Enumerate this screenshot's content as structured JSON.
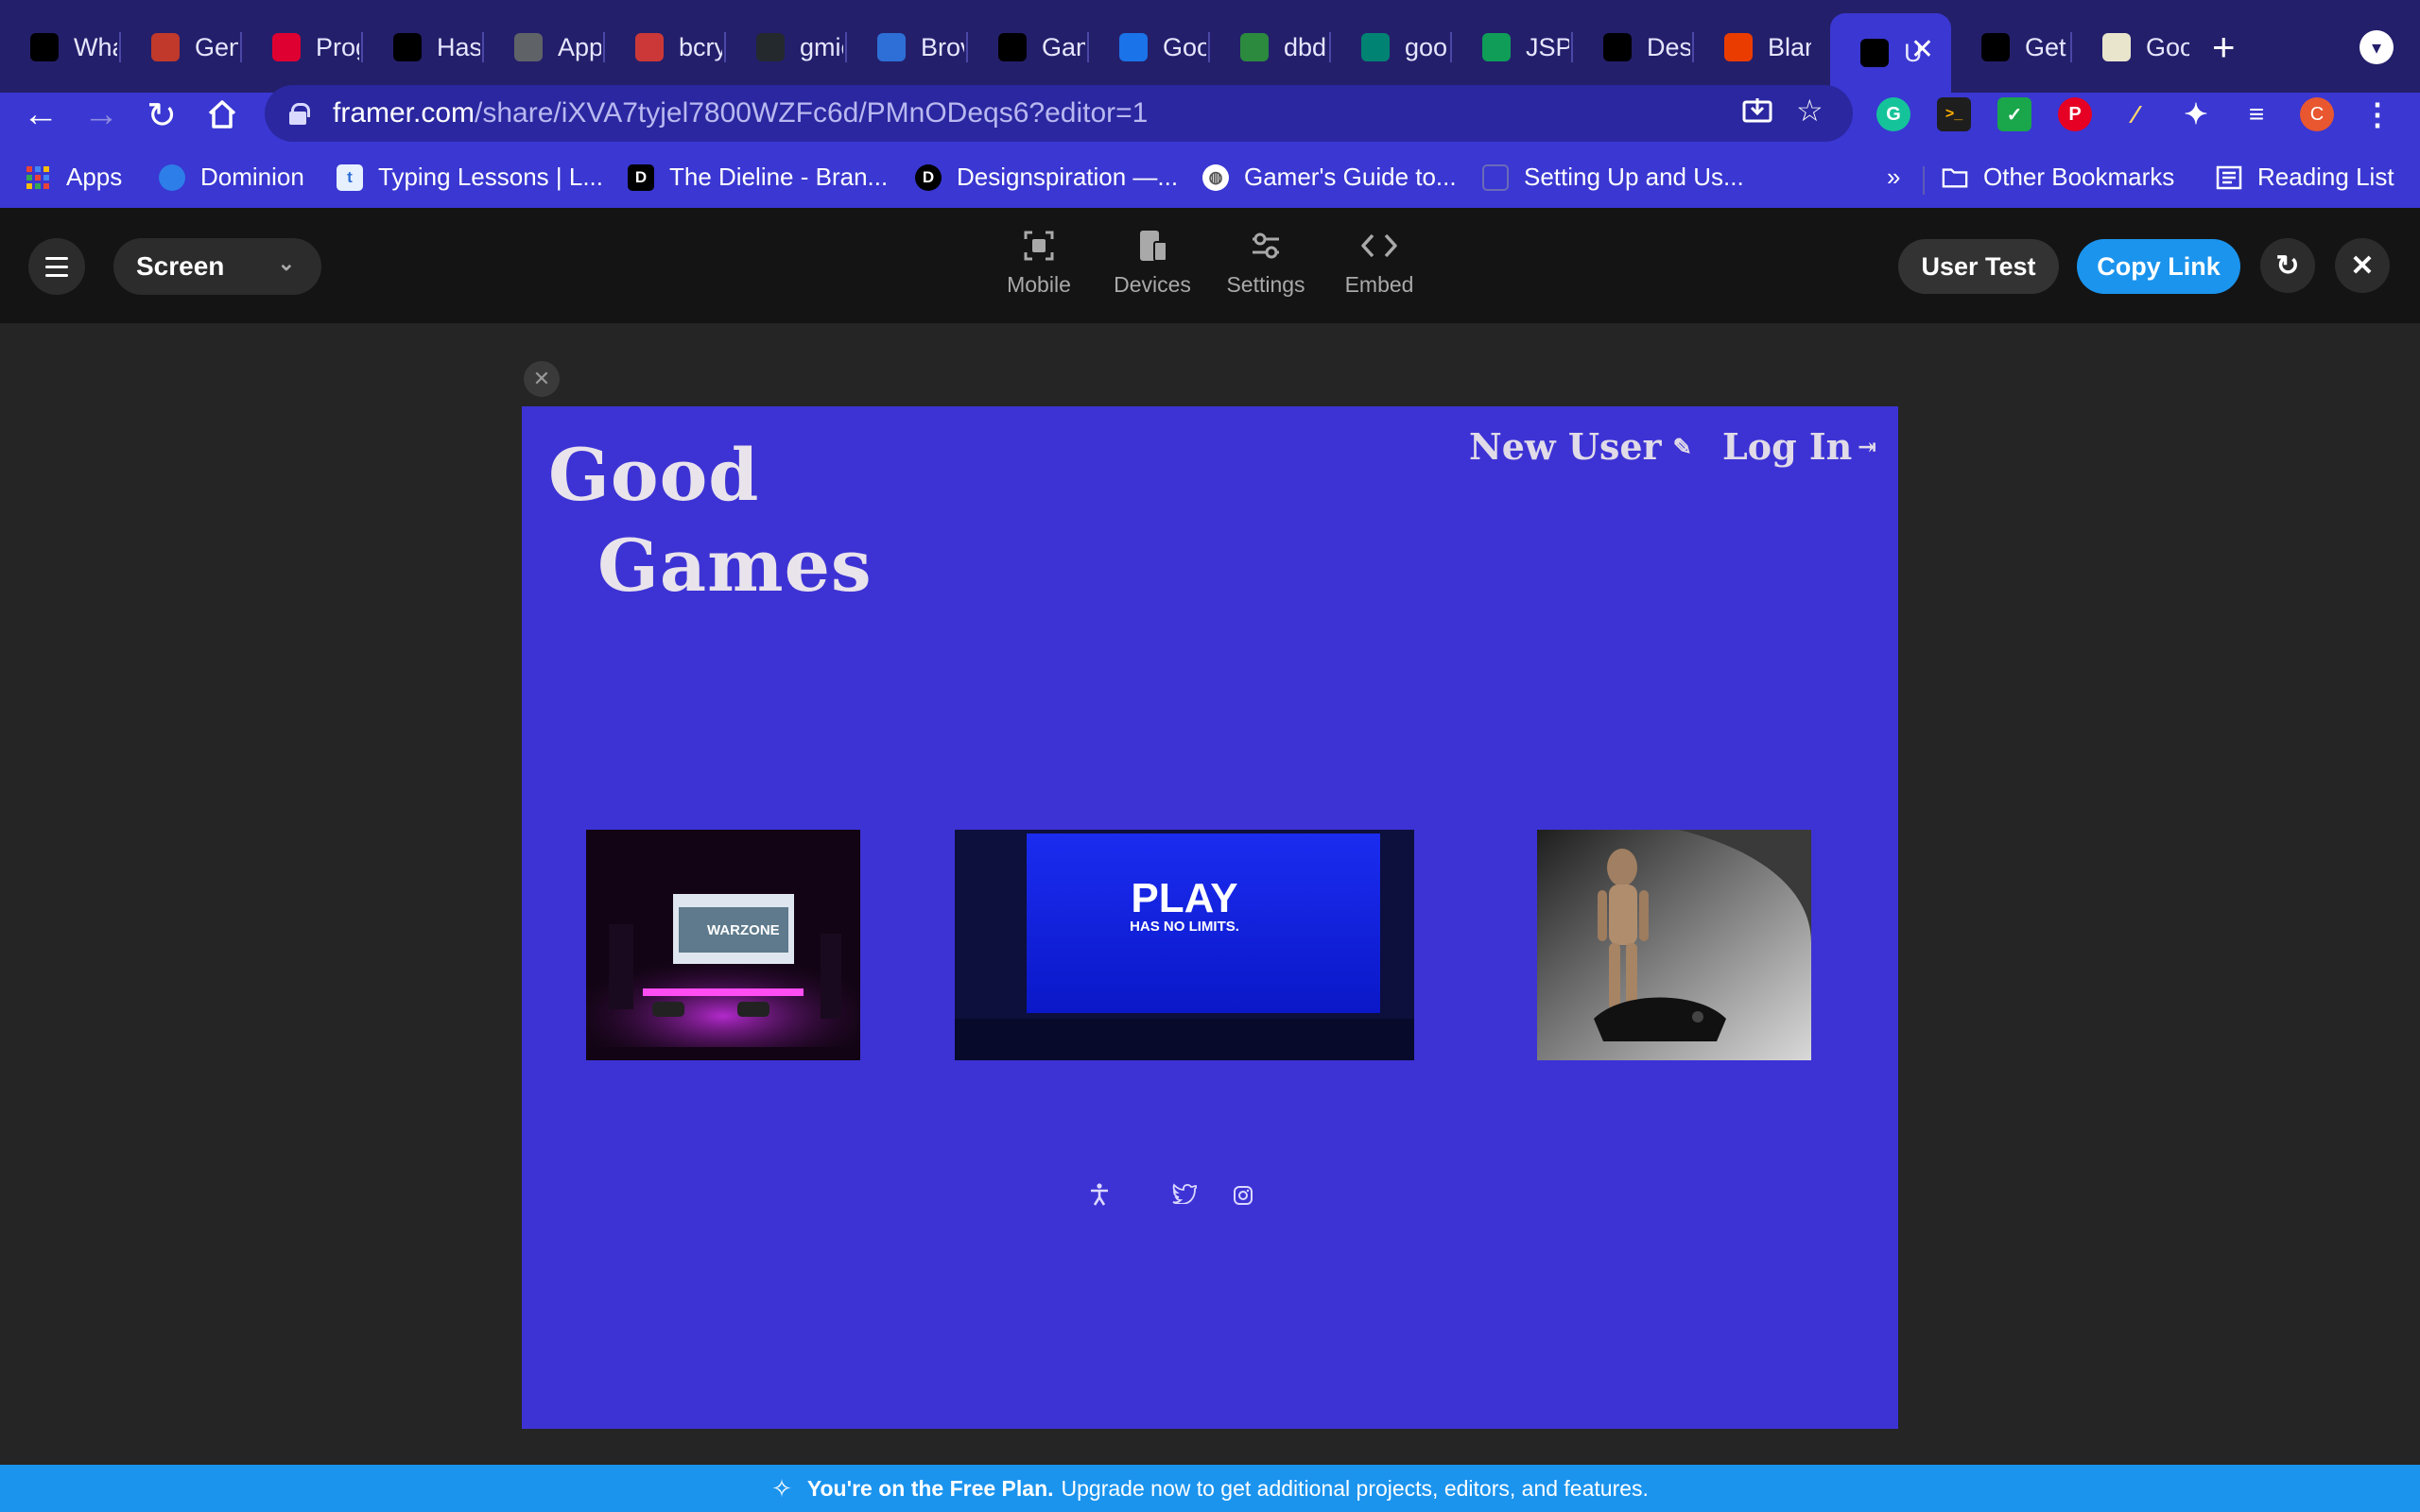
{
  "browser": {
    "tabs": [
      {
        "title": "Wha",
        "icon": "paw-icon",
        "color": "#000000"
      },
      {
        "title": "Gen",
        "icon": "book-icon",
        "color": "#c0392b"
      },
      {
        "title": "Prog",
        "icon": "angular-icon",
        "color": "#dd0031"
      },
      {
        "title": "Hasl",
        "icon": "paw-icon",
        "color": "#000000"
      },
      {
        "title": "App",
        "icon": "globe-icon",
        "color": "#5f6368"
      },
      {
        "title": "bcry",
        "icon": "npm-icon",
        "color": "#cb3837"
      },
      {
        "title": "gmic",
        "icon": "github-icon",
        "color": "#24292e"
      },
      {
        "title": "Brov",
        "icon": "blocks-icon",
        "color": "#2d6fd6"
      },
      {
        "title": "Gam",
        "icon": "planet-icon",
        "color": "#000000"
      },
      {
        "title": "Goo",
        "icon": "share-icon",
        "color": "#1a73e8"
      },
      {
        "title": "dbdi",
        "icon": "earth-icon",
        "color": "#2b8a3e"
      },
      {
        "title": "goo",
        "icon": "bing-icon",
        "color": "#008373"
      },
      {
        "title": "JSP",
        "icon": "sheets-icon",
        "color": "#0f9d58"
      },
      {
        "title": "Desi",
        "icon": "d-icon",
        "color": "#000000"
      },
      {
        "title": "Blan",
        "icon": "office-icon",
        "color": "#eb3c00"
      },
      {
        "title": "U",
        "icon": "framer-icon",
        "color": "#000000",
        "active": true
      },
      {
        "title": "Get",
        "icon": "framer-icon",
        "color": "#000000"
      },
      {
        "title": "Goo",
        "icon": "goodreads-icon",
        "color": "#e9e5cd"
      }
    ],
    "url_domain": "framer.com",
    "url_path": "/share/iXVA7tyjel7800WZFc6d/PMnODeqs6?editor=1",
    "profile_initial": "C",
    "bookmarks": [
      {
        "label": "Apps",
        "icon": "apps-grid-icon"
      },
      {
        "label": "Dominion",
        "icon": "dominion-icon"
      },
      {
        "label": "Typing Lessons | L...",
        "icon": "typing-icon"
      },
      {
        "label": "The Dieline - Bran...",
        "icon": "d-icon"
      },
      {
        "label": "Designspiration —...",
        "icon": "d-icon"
      },
      {
        "label": "Gamer's Guide to...",
        "icon": "globe-icon"
      },
      {
        "label": "Setting Up and Us...",
        "icon": "page-icon"
      }
    ],
    "overflow_label": "»",
    "other_bookmarks": "Other Bookmarks",
    "reading_list": "Reading List"
  },
  "framer": {
    "screen_select": "Screen",
    "tools": [
      {
        "label": "Mobile",
        "icon": "mobile-frame-icon"
      },
      {
        "label": "Devices",
        "icon": "devices-icon"
      },
      {
        "label": "Settings",
        "icon": "sliders-icon"
      },
      {
        "label": "Embed",
        "icon": "code-icon"
      }
    ],
    "user_test": "User Test",
    "copy_link": "Copy Link",
    "banner_bold": "You're on the Free Plan.",
    "banner_text": "Upgrade now to get additional projects, editors, and features."
  },
  "site": {
    "brand_line1": "Good",
    "brand_line2": "Games",
    "new_user": "New User",
    "log_in": "Log In",
    "hero_play": "PLAY",
    "hero_tagline": "HAS NO LIMITS.",
    "warzone": "WARZONE",
    "background_color": "#3d33d4"
  }
}
